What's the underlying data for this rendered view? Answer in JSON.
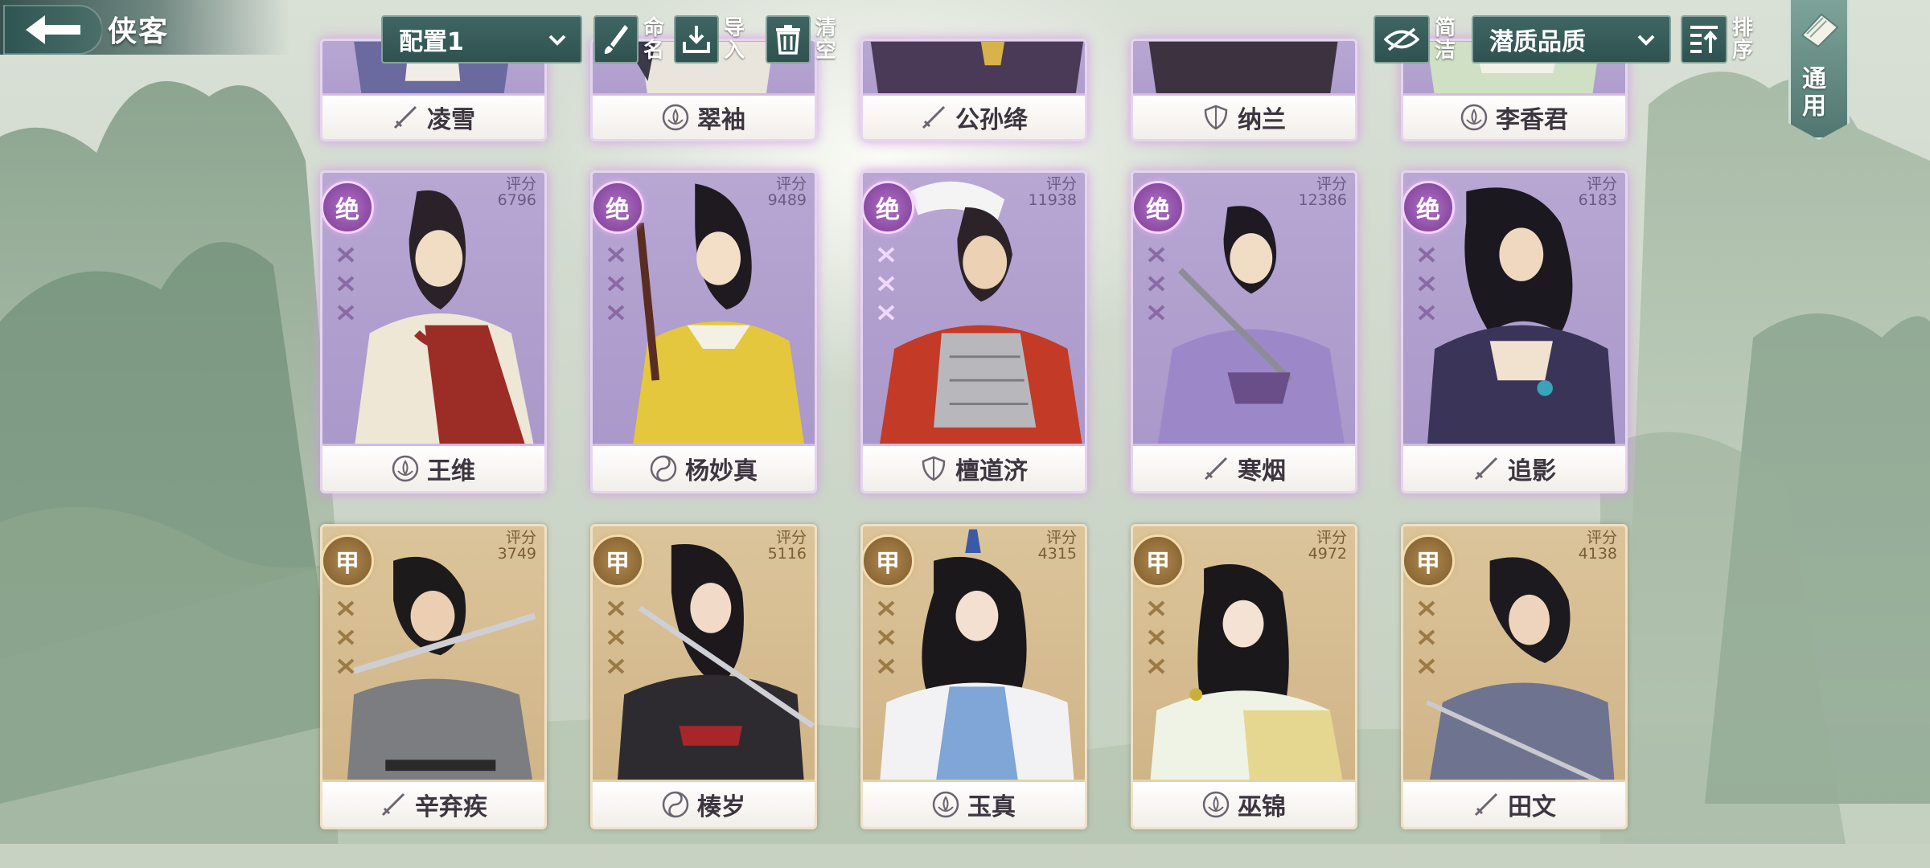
{
  "header": {
    "title": "侠客",
    "config_dropdown": "配置1",
    "rename_label": "命名",
    "import_label": "导入",
    "clear_label": "清空",
    "simple_label": "简洁",
    "sort_dropdown": "潜质品质",
    "sort_label": "排序",
    "general_tab": "通用"
  },
  "colors": {
    "jue": "#a796c8",
    "jia": "#cdb284",
    "ui_teal": "#2f5250"
  },
  "row1": [
    {
      "name": "凌雪",
      "icon": "sword-icon"
    },
    {
      "name": "翠袖",
      "icon": "lotus-icon"
    },
    {
      "name": "公孙绛",
      "icon": "sword-icon"
    },
    {
      "name": "纳兰",
      "icon": "shield-icon"
    },
    {
      "name": "李香君",
      "icon": "lotus-icon"
    }
  ],
  "row2": [
    {
      "name": "王维",
      "icon": "lotus-icon",
      "rank": "绝",
      "score_label": "评分",
      "score": "6796"
    },
    {
      "name": "杨妙真",
      "icon": "taiji-icon",
      "rank": "绝",
      "score_label": "评分",
      "score": "9489"
    },
    {
      "name": "檀道济",
      "icon": "shield-icon",
      "rank": "绝",
      "score_label": "评分",
      "score": "11938"
    },
    {
      "name": "寒烟",
      "icon": "sword-icon",
      "rank": "绝",
      "score_label": "评分",
      "score": "12386"
    },
    {
      "name": "追影",
      "icon": "sword-icon",
      "rank": "绝",
      "score_label": "评分",
      "score": "6183"
    }
  ],
  "row3": [
    {
      "name": "辛弃疾",
      "icon": "sword-icon",
      "rank": "甲",
      "score_label": "评分",
      "score": "3749"
    },
    {
      "name": "楱岁",
      "icon": "taiji-icon",
      "rank": "甲",
      "score_label": "评分",
      "score": "5116"
    },
    {
      "name": "玉真",
      "icon": "lotus-icon",
      "rank": "甲",
      "score_label": "评分",
      "score": "4315"
    },
    {
      "name": "巫锦",
      "icon": "lotus-icon",
      "rank": "甲",
      "score_label": "评分",
      "score": "4972"
    },
    {
      "name": "田文",
      "icon": "sword-icon",
      "rank": "甲",
      "score_label": "评分",
      "score": "4138"
    }
  ]
}
